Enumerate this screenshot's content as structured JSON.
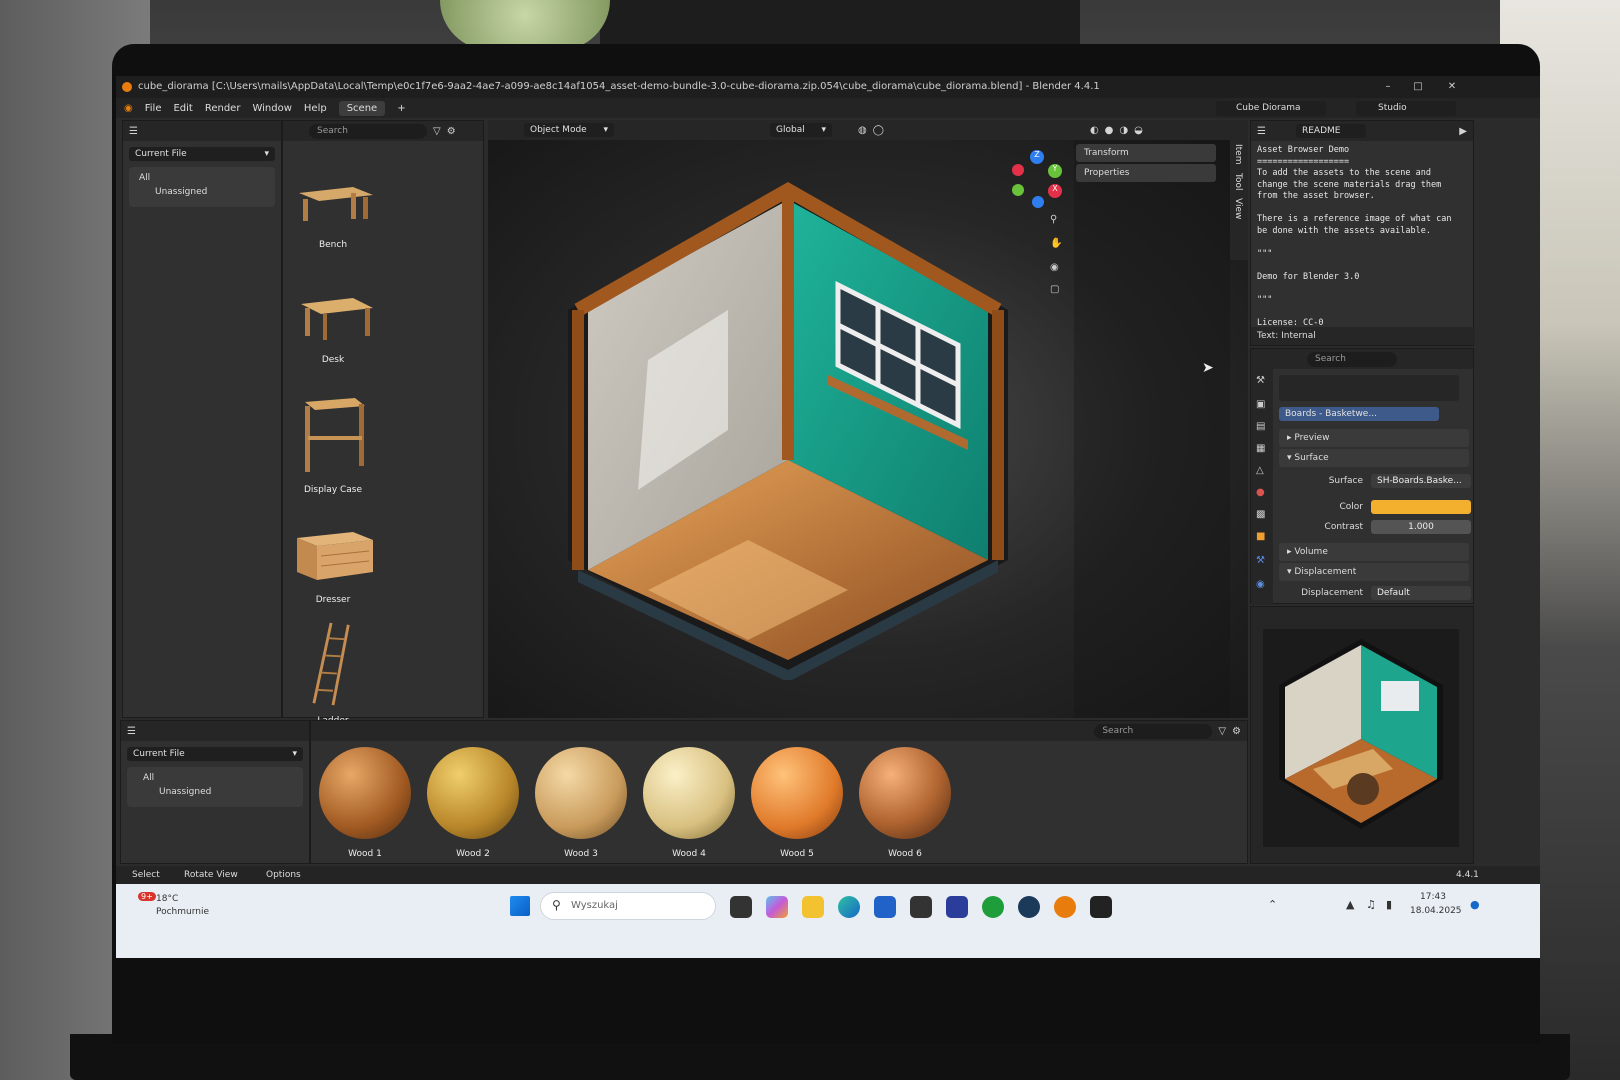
{
  "window": {
    "title": "cube_diorama [C:\\Users\\mails\\AppData\\Local\\Temp\\e0c1f7e6-9aa2-4ae7-a099-ae8c14af1054_asset-demo-bundle-3.0-cube-diorama.zip.054\\cube_diorama\\cube_diorama.blend] - Blender 4.4.1"
  },
  "menu": {
    "items": [
      "File",
      "Edit",
      "Render",
      "Window",
      "Help"
    ],
    "active_tab": "Scene",
    "scene_name": "Cube Diorama",
    "view_layer": "Studio"
  },
  "asset_browser_side": {
    "library": "Current File",
    "catalogs": [
      "All",
      "Unassigned"
    ],
    "search_placeholder": "Search",
    "assets": [
      "Bench",
      "Desk",
      "Display Case",
      "Dresser",
      "Ladder"
    ]
  },
  "viewport": {
    "mode": "Object Mode",
    "orientation": "Global",
    "n_panel": [
      "Transform",
      "Properties"
    ],
    "side_tabs": [
      "Item",
      "Tool",
      "View"
    ],
    "gizmo_axes": [
      "X",
      "Y",
      "Z"
    ]
  },
  "text_editor": {
    "file": "README",
    "lines": [
      "Asset Browser Demo",
      "==================",
      "To add the assets to the scene and",
      "change the scene materials drag them",
      "from the asset browser.",
      "",
      "There is a reference image of what can",
      "be done with the assets available.",
      "",
      "\"\"\"",
      "",
      "Demo for Blender 3.0",
      "",
      "\"\"\"",
      "",
      "License: CC-0"
    ],
    "footer": "Text: Internal"
  },
  "properties": {
    "search_placeholder": "Search",
    "material": "Boards - Basketwe...",
    "sections": [
      "Preview",
      "Surface",
      "Volume",
      "Displacement"
    ],
    "surface_label": "Surface",
    "surface_value": "SH-Boards.Baske...",
    "color_label": "Color",
    "color_value": "#f2b02e",
    "contrast_label": "Contrast",
    "contrast_value": "1.000",
    "displacement_label": "Displacement",
    "displacement_value": "Default"
  },
  "asset_browser_bottom": {
    "library": "Current File",
    "catalogs": [
      "All",
      "Unassigned"
    ],
    "search_placeholder": "Search",
    "materials": [
      "Wood 1",
      "Wood 2",
      "Wood 3",
      "Wood 4",
      "Wood 5",
      "Wood 6"
    ]
  },
  "statusbar": {
    "select": "Select",
    "rotate": "Rotate View",
    "options": "Options",
    "version": "4.4.1"
  },
  "taskbar": {
    "weather_temp": "18°C",
    "weather_desc": "Pochmurnie",
    "badge": "9+",
    "search_placeholder": "Wyszukaj",
    "time": "17:43",
    "date": "18.04.2025"
  }
}
